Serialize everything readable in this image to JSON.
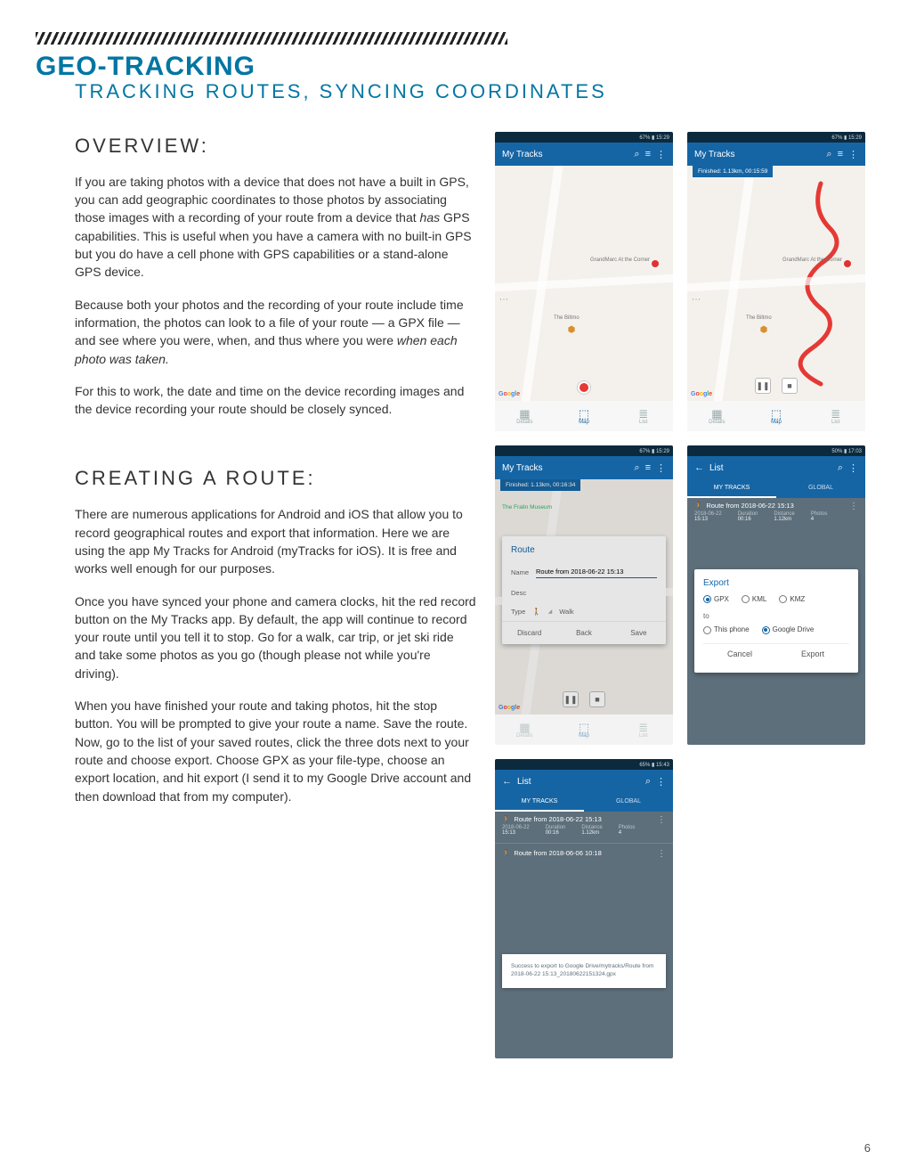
{
  "header": {
    "title": "GEO-TRACKING",
    "subtitle": "TRACKING ROUTES, SYNCING COORDINATES"
  },
  "overview": {
    "heading": "OVERVIEW:",
    "p1a": "If you are taking photos with a device that does not have a built in GPS, you can add geographic coordinates to those photos by associating those images with a recording of your route from a device that ",
    "p1em": "has",
    "p1b": " GPS capabilities. This is useful when you have a camera with no built-in GPS but you do have a cell phone with GPS capabilities or a stand-alone GPS device.",
    "p2a": "Because both your photos and the recording of your route include time information, the photos can look to a file of your route — a GPX file — and see where you were, when, and thus where you were ",
    "p2em": "when each photo was taken.",
    "p3": "For this to work, the date and time on the device recording images and the device recording your route should be closely synced."
  },
  "creating": {
    "heading": "CREATING A ROUTE:",
    "p1": "There are numerous applications for Android and iOS that allow you to record geographical routes and export that information. Here we are using the app My Tracks for Android (myTracks for iOS). It is free and works well enough for our purposes.",
    "p2": "Once you have synced your phone and camera clocks, hit the red record button on the My Tracks app. By default, the app will continue to record your route until you tell it to stop. Go for a walk, car trip, or jet ski ride and take some photos as you go (though please not while you're driving).",
    "p3": "When you have finished your route and taking photos, hit the stop button. You will be prompted to give your route a name. Save the route. Now, go to the list of your saved routes, click the three dots next to your route and choose export. Choose GPX as your file-type, choose an export location, and hit export (I send it to my Google Drive account and then download that from my computer)."
  },
  "phones": {
    "status1": "67% ▮ 15:29",
    "status2": "67% ▮ 15:29",
    "status3": "67% ▮ 15:29",
    "status4": "50% ▮ 17:03",
    "status5": "65% ▮ 15:43",
    "appTitleTracks": "My Tracks",
    "appTitleList": "List",
    "bubble2": "Finished: 1.13km, 00:15:59",
    "bubble3": "Finished: 1.13km, 00:16:34",
    "poi1": "GrandMarc At the Corner",
    "poi2": "The Biltmo",
    "poi3": "The Fralin Museum",
    "tabDetails": "Details",
    "tabMap": "Map",
    "tabList": "List",
    "tabMyTracks": "MY TRACKS",
    "tabGlobal": "GLOBAL",
    "dialog": {
      "title": "Route",
      "nameLabel": "Name",
      "nameValue": "Route from 2018-06-22 15:13",
      "descLabel": "Desc",
      "typeLabel": "Type",
      "typeValue": "Walk",
      "discard": "Discard",
      "back": "Back",
      "save": "Save"
    },
    "routeItem": {
      "title": "Route from 2018-06-22 15:13",
      "dateL": "2018-06-22",
      "dateV": "15:13",
      "durL": "Duration",
      "durV": "00:16",
      "distL": "Distance",
      "distV": "1.12km",
      "phL": "Photos",
      "phV": "4"
    },
    "routeItem2": "Route from 2018-06-06 10:18",
    "export": {
      "title": "Export",
      "gpx": "GPX",
      "kml": "KML",
      "kmz": "KMZ",
      "to": "to",
      "thisPhone": "This phone",
      "gdrive": "Google Drive",
      "cancel": "Cancel",
      "export": "Export"
    },
    "snackbar": "Success to export to Google Drive/mytracks/Route from 2018-06-22 15:13_20180622151324.gpx"
  },
  "pageNumber": "6"
}
